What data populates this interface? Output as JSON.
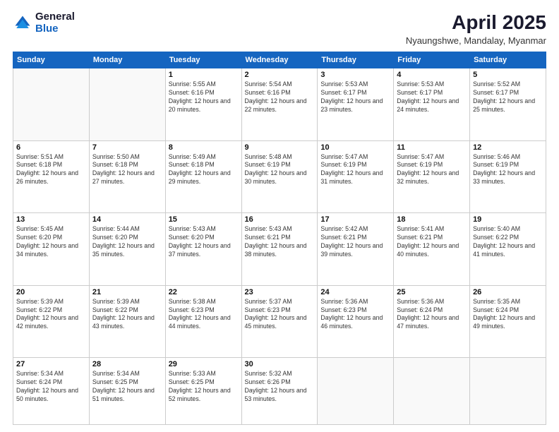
{
  "logo": {
    "general": "General",
    "blue": "Blue"
  },
  "header": {
    "month": "April 2025",
    "location": "Nyaungshwe, Mandalay, Myanmar"
  },
  "weekdays": [
    "Sunday",
    "Monday",
    "Tuesday",
    "Wednesday",
    "Thursday",
    "Friday",
    "Saturday"
  ],
  "weeks": [
    [
      {
        "day": "",
        "info": ""
      },
      {
        "day": "",
        "info": ""
      },
      {
        "day": "1",
        "info": "Sunrise: 5:55 AM\nSunset: 6:16 PM\nDaylight: 12 hours and 20 minutes."
      },
      {
        "day": "2",
        "info": "Sunrise: 5:54 AM\nSunset: 6:16 PM\nDaylight: 12 hours and 22 minutes."
      },
      {
        "day": "3",
        "info": "Sunrise: 5:53 AM\nSunset: 6:17 PM\nDaylight: 12 hours and 23 minutes."
      },
      {
        "day": "4",
        "info": "Sunrise: 5:53 AM\nSunset: 6:17 PM\nDaylight: 12 hours and 24 minutes."
      },
      {
        "day": "5",
        "info": "Sunrise: 5:52 AM\nSunset: 6:17 PM\nDaylight: 12 hours and 25 minutes."
      }
    ],
    [
      {
        "day": "6",
        "info": "Sunrise: 5:51 AM\nSunset: 6:18 PM\nDaylight: 12 hours and 26 minutes."
      },
      {
        "day": "7",
        "info": "Sunrise: 5:50 AM\nSunset: 6:18 PM\nDaylight: 12 hours and 27 minutes."
      },
      {
        "day": "8",
        "info": "Sunrise: 5:49 AM\nSunset: 6:18 PM\nDaylight: 12 hours and 29 minutes."
      },
      {
        "day": "9",
        "info": "Sunrise: 5:48 AM\nSunset: 6:19 PM\nDaylight: 12 hours and 30 minutes."
      },
      {
        "day": "10",
        "info": "Sunrise: 5:47 AM\nSunset: 6:19 PM\nDaylight: 12 hours and 31 minutes."
      },
      {
        "day": "11",
        "info": "Sunrise: 5:47 AM\nSunset: 6:19 PM\nDaylight: 12 hours and 32 minutes."
      },
      {
        "day": "12",
        "info": "Sunrise: 5:46 AM\nSunset: 6:19 PM\nDaylight: 12 hours and 33 minutes."
      }
    ],
    [
      {
        "day": "13",
        "info": "Sunrise: 5:45 AM\nSunset: 6:20 PM\nDaylight: 12 hours and 34 minutes."
      },
      {
        "day": "14",
        "info": "Sunrise: 5:44 AM\nSunset: 6:20 PM\nDaylight: 12 hours and 35 minutes."
      },
      {
        "day": "15",
        "info": "Sunrise: 5:43 AM\nSunset: 6:20 PM\nDaylight: 12 hours and 37 minutes."
      },
      {
        "day": "16",
        "info": "Sunrise: 5:43 AM\nSunset: 6:21 PM\nDaylight: 12 hours and 38 minutes."
      },
      {
        "day": "17",
        "info": "Sunrise: 5:42 AM\nSunset: 6:21 PM\nDaylight: 12 hours and 39 minutes."
      },
      {
        "day": "18",
        "info": "Sunrise: 5:41 AM\nSunset: 6:21 PM\nDaylight: 12 hours and 40 minutes."
      },
      {
        "day": "19",
        "info": "Sunrise: 5:40 AM\nSunset: 6:22 PM\nDaylight: 12 hours and 41 minutes."
      }
    ],
    [
      {
        "day": "20",
        "info": "Sunrise: 5:39 AM\nSunset: 6:22 PM\nDaylight: 12 hours and 42 minutes."
      },
      {
        "day": "21",
        "info": "Sunrise: 5:39 AM\nSunset: 6:22 PM\nDaylight: 12 hours and 43 minutes."
      },
      {
        "day": "22",
        "info": "Sunrise: 5:38 AM\nSunset: 6:23 PM\nDaylight: 12 hours and 44 minutes."
      },
      {
        "day": "23",
        "info": "Sunrise: 5:37 AM\nSunset: 6:23 PM\nDaylight: 12 hours and 45 minutes."
      },
      {
        "day": "24",
        "info": "Sunrise: 5:36 AM\nSunset: 6:23 PM\nDaylight: 12 hours and 46 minutes."
      },
      {
        "day": "25",
        "info": "Sunrise: 5:36 AM\nSunset: 6:24 PM\nDaylight: 12 hours and 47 minutes."
      },
      {
        "day": "26",
        "info": "Sunrise: 5:35 AM\nSunset: 6:24 PM\nDaylight: 12 hours and 49 minutes."
      }
    ],
    [
      {
        "day": "27",
        "info": "Sunrise: 5:34 AM\nSunset: 6:24 PM\nDaylight: 12 hours and 50 minutes."
      },
      {
        "day": "28",
        "info": "Sunrise: 5:34 AM\nSunset: 6:25 PM\nDaylight: 12 hours and 51 minutes."
      },
      {
        "day": "29",
        "info": "Sunrise: 5:33 AM\nSunset: 6:25 PM\nDaylight: 12 hours and 52 minutes."
      },
      {
        "day": "30",
        "info": "Sunrise: 5:32 AM\nSunset: 6:26 PM\nDaylight: 12 hours and 53 minutes."
      },
      {
        "day": "",
        "info": ""
      },
      {
        "day": "",
        "info": ""
      },
      {
        "day": "",
        "info": ""
      }
    ]
  ]
}
